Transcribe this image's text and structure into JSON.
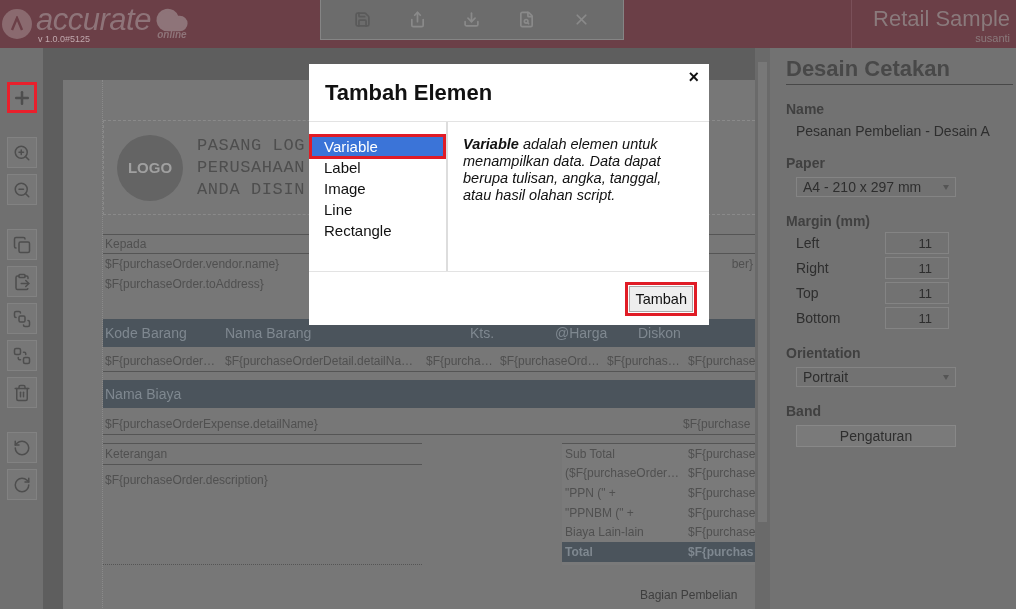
{
  "app": {
    "brand": "accurate",
    "version": "v 1.0.0#5125",
    "edition": "online",
    "company": "Retail Sample",
    "user": "susanti"
  },
  "toolbar": [
    {
      "kind": "save",
      "disabled": true
    },
    {
      "kind": "export",
      "disabled": false
    },
    {
      "kind": "download",
      "disabled": false
    },
    {
      "kind": "preview",
      "disabled": false
    },
    {
      "kind": "close",
      "disabled": false
    }
  ],
  "side_tools": [
    {
      "kind": "add",
      "highlighted": true
    },
    {
      "kind": "zoom-in",
      "highlighted": false
    },
    {
      "kind": "zoom-out",
      "highlighted": false
    },
    {
      "kind": "copy",
      "highlighted": false
    },
    {
      "kind": "paste",
      "highlighted": false
    },
    {
      "kind": "bring-front",
      "highlighted": false
    },
    {
      "kind": "send-back",
      "highlighted": false
    },
    {
      "kind": "delete",
      "highlighted": false
    },
    {
      "kind": "undo",
      "highlighted": false
    },
    {
      "kind": "redo",
      "highlighted": false
    }
  ],
  "document": {
    "logo": "LOGO",
    "logo_lines": [
      "PASANG LOG",
      "PERUSAHAAN",
      "ANDA DISIN"
    ],
    "recipient_label": "Kepada",
    "recipient_lines": [
      "$F{purchaseOrder.vendor.name}",
      "$F{purchaseOrder.toAddress}"
    ],
    "recipient_right": "ber}",
    "item_columns": [
      "Kode Barang",
      "Nama Barang",
      "Kts.",
      "@Harga",
      "Diskon"
    ],
    "item_row": [
      "$F{purchaseOrder…",
      "$F{purchaseOrderDetail.detailNa…",
      "$F{purcha…",
      "$F{purchaseOrd…",
      "$F{purchas…",
      "$F{purchase"
    ],
    "expense_column": "Nama Biaya",
    "expense_row": [
      "$F{purchaseOrderExpense.detailName}",
      "$F{purchase"
    ],
    "notes_label": "Keterangan",
    "notes_value": "$F{purchaseOrder.description}",
    "totals": [
      {
        "label": "Sub Total",
        "value": "$F{purchase",
        "total": false
      },
      {
        "label": "($F{purchaseOrder…",
        "value": "$F{purchase",
        "total": false
      },
      {
        "label": "\"PPN (\" +",
        "value": "$F{purchase",
        "total": false
      },
      {
        "label": "\"PPNBM (\" +",
        "value": "$F{purchase",
        "total": false
      },
      {
        "label": "Biaya Lain-lain",
        "value": "$F{purchase",
        "total": false
      },
      {
        "label": "Total",
        "value": "$F{purchas",
        "total": true
      }
    ],
    "signature": "Bagian Pembelian"
  },
  "properties": {
    "title": "Desain Cetakan",
    "name_label": "Name",
    "name_value": "Pesanan Pembelian - Desain A",
    "paper_label": "Paper",
    "paper_value": "A4 - 210 x 297 mm",
    "margin_label": "Margin (mm)",
    "margins": [
      {
        "label": "Left",
        "value": "11"
      },
      {
        "label": "Right",
        "value": "11"
      },
      {
        "label": "Top",
        "value": "11"
      },
      {
        "label": "Bottom",
        "value": "11"
      }
    ],
    "orientation_label": "Orientation",
    "orientation_value": "Portrait",
    "band_label": "Band",
    "band_button": "Pengaturan"
  },
  "dialog": {
    "title": "Tambah Elemen",
    "close": "×",
    "items": [
      {
        "label": "Variable",
        "selected": true,
        "highlighted": true
      },
      {
        "label": "Label",
        "selected": false,
        "highlighted": false
      },
      {
        "label": "Image",
        "selected": false,
        "highlighted": false
      },
      {
        "label": "Line",
        "selected": false,
        "highlighted": false
      },
      {
        "label": "Rectangle",
        "selected": false,
        "highlighted": false
      }
    ],
    "description": "**Variable** adalah elemen untuk menampilkan data. Data dapat berupa tulisan, angka, tanggal, atau hasil olahan script.",
    "button": {
      "label": "Tambah",
      "highlighted": true
    }
  }
}
